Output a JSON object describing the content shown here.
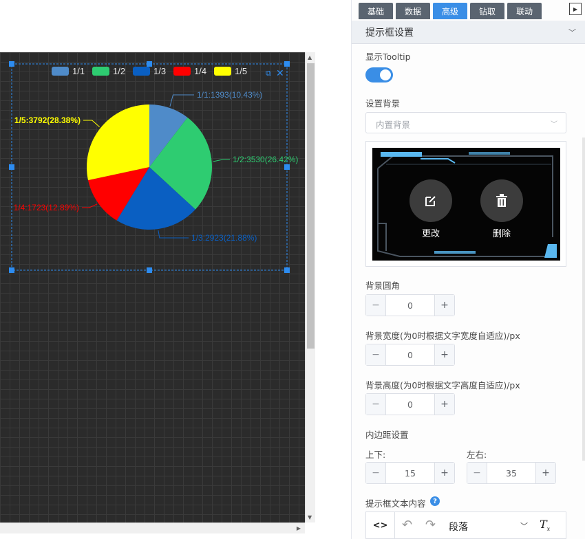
{
  "tabs": [
    {
      "label": "基础",
      "active": false
    },
    {
      "label": "数据",
      "active": false
    },
    {
      "label": "高级",
      "active": true
    },
    {
      "label": "钻取",
      "active": false
    },
    {
      "label": "联动",
      "active": false
    }
  ],
  "section": {
    "title": "提示框设置"
  },
  "tooltip": {
    "label": "显示Tooltip",
    "enabled": true
  },
  "background": {
    "label": "设置背景",
    "select_placeholder": "内置背景",
    "change_label": "更改",
    "delete_label": "删除"
  },
  "radius": {
    "label": "背景圆角",
    "value": "0"
  },
  "width": {
    "label": "背景宽度(为0时根据文字宽度自适应)/px",
    "value": "0"
  },
  "height": {
    "label": "背景高度(为0时根据文字高度自适应)/px",
    "value": "0"
  },
  "padding": {
    "label": "内边距设置",
    "vertical_label": "上下:",
    "vertical_value": "15",
    "horizontal_label": "左右:",
    "horizontal_value": "35"
  },
  "content": {
    "label": "提示框文本内容",
    "paragraph_label": "段落"
  },
  "colors": {
    "accent": "#3a8ee6",
    "tab_bg": "#5a6470"
  },
  "chart_data": {
    "type": "pie",
    "legend_position": "top-right",
    "slices": [
      {
        "name": "1/1",
        "value": 1393,
        "percent": "10.43%",
        "color": "#4f8bc9",
        "label": "1/1:1393(10.43%)"
      },
      {
        "name": "1/2",
        "value": 3530,
        "percent": "26.42%",
        "color": "#2ecc71",
        "label": "1/2:3530(26.42%)"
      },
      {
        "name": "1/3",
        "value": 2923,
        "percent": "21.88%",
        "color": "#0a5fc2",
        "label": "1/3:2923(21.88%)"
      },
      {
        "name": "1/4",
        "value": 1723,
        "percent": "12.89%",
        "color": "#ff0000",
        "label": "1/4:1723(12.89%)"
      },
      {
        "name": "1/5",
        "value": 3792,
        "percent": "28.38%",
        "color": "#ffff00",
        "label": "1/5:3792(28.38%)"
      }
    ]
  }
}
